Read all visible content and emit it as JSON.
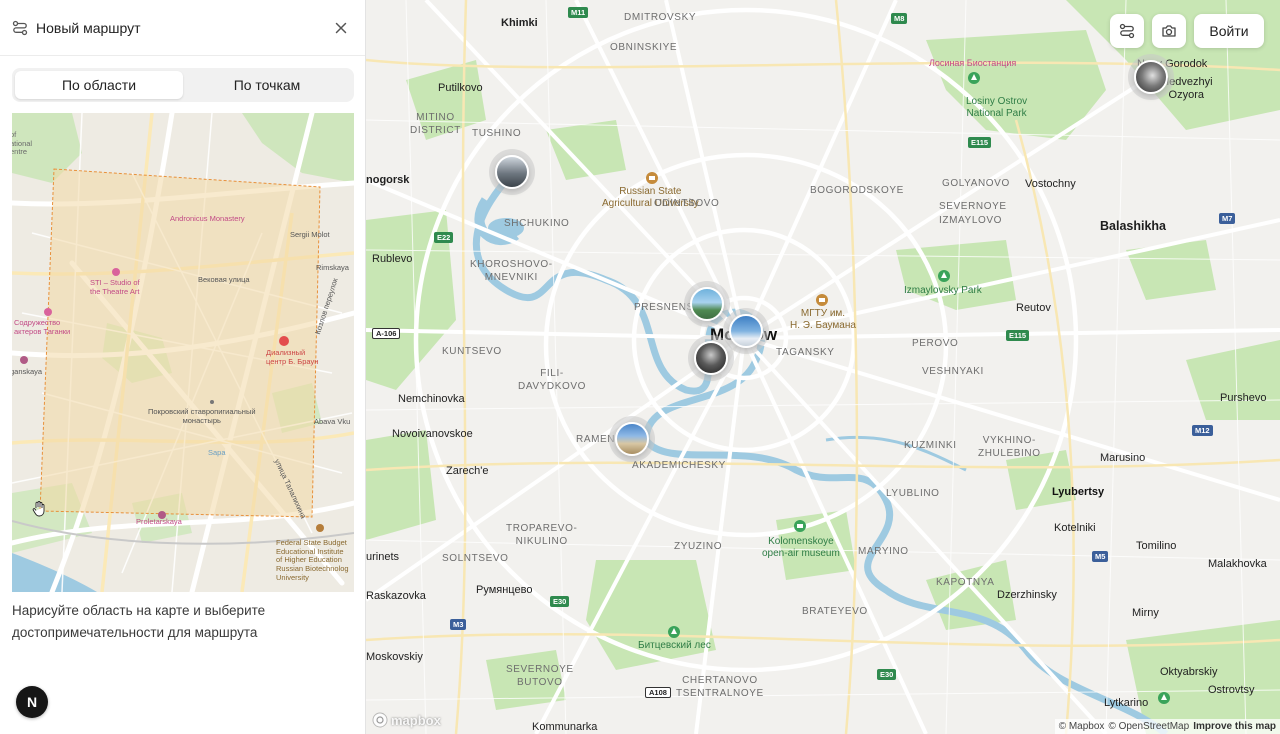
{
  "panel": {
    "title": "Новый маршрут",
    "tabs": [
      {
        "label": "По области",
        "active": true
      },
      {
        "label": "По точкам",
        "active": false
      }
    ],
    "hint": "Нарисуйте область на карте и выберите достопримечательности для маршрута",
    "user_initial": "N"
  },
  "preview_labels": {
    "andronicus": "Andronicus Monastery",
    "sergii": "Sergii Molot",
    "rimskaya": "Rimskaya",
    "sti": "STI – Studio of\nthe Theatre Art",
    "vekovaya": "Вековая улица",
    "sodruzh": "Содружество\nактеров Таганки",
    "taganskaya": "ganskaya",
    "taganskiy": "TAGANSKY",
    "dialysis": "Диализный\nцентр Б. Браун",
    "kozlov": "Козлов переулок",
    "pokrovsky": "Покровский ставропигиальный\nмонастырь",
    "abava": "Abava Vku",
    "sapa": "Sapa",
    "talalikhina": "улица Талалихина",
    "national": "of\national\nentre",
    "proletarskaya": "Proletarskaya",
    "federal": "Federal State Budget\nEducational Institute\nof Higher Education\nRussian Biotechnolog\nUniversity"
  },
  "map": {
    "buttons": {
      "login": "Войти"
    },
    "labels": {
      "khimki": "Khimki",
      "novy_gorodok": "Novy Gorodok",
      "medvezhyi": "Medvezhyi\nOzyora",
      "losiny": "Losiny Ostrov\nNational Park",
      "losinaya": "Лосиная Биостанция",
      "putilkovo": "Putilkovo",
      "krasnogorsk": "nogorsk",
      "rsau": "Russian State\nAgricultural University",
      "balashikha": "Balashikha",
      "golyanovo": "GOLYANOVO",
      "vostochny": "Vostochny",
      "severnoye_izm": "SEVERNOYE\nIZMAYLOVO",
      "bogorodskoye": "BOGORODSKOYE",
      "rublevo": "Rublevo",
      "izmaylovsky_park": "Izmaylovsky Park",
      "reutov": "Reutov",
      "presnensky": "PRESNENSKY",
      "mgtu": "МГТУ им.\nН. Э. Баумана",
      "moscow": "Moscow",
      "taganskiy": "TAGANSKY",
      "perovo": "PEROVO",
      "veshnyaki": "VESHNYAKI",
      "kuntsevo": "KUNTSEVO",
      "fili": "FILI-\nDAVYDKOVO",
      "khoroshovo": "KHOROSHOVO-\nMNEVNIKI",
      "shchukino": "SHCHUKINO",
      "tushino": "TUSHINO",
      "mitino": "MITINO\nDISTRICT",
      "ochakovo": "OBNINSKIYE",
      "nemchinovka": "Nemchinovka",
      "novoivanovskoe": "Novoivanovskoe",
      "ramenki": "RAMENKI",
      "zarechye": "Zarech'e",
      "akademichesky": "AKADEMICHESKY",
      "kuzminki": "KUZMINKI",
      "vykhino": "VYKHINO-\nZHULEBINO",
      "marusino": "Marusino",
      "lyubertsy": "Lyubertsy",
      "purshevo": "Purshevo",
      "lyublino": "LYUBLINO",
      "kolomenskoye": "Kolomenskoye\nopen-air museum",
      "maryino": "MARYINO",
      "kotelniki": "Kotelniki",
      "tomilino": "Tomilino",
      "malakhovka": "Malakhovka",
      "troparevo": "TROPAREVO-\nNIKULINO",
      "solntsevo": "SOLNTSEVO",
      "vnukovo": "urinets",
      "zyuzino": "ZYUZINO",
      "rumyantsevo": "Румянцево",
      "kapotnya": "KAPOTNYA",
      "dzerzhinsky": "Dzerzhinsky",
      "mirny": "Mirny",
      "oktyabrsky": "Oktyabrskiy",
      "bitsevsky": "Битцевский лес",
      "severnoye_butovo": "SEVERNOYE\nBUTOVO",
      "chertanovo": "CHERTANOVO\nTSENTRALNOYE",
      "brateyevo": "BRATEYEVO",
      "moskovskiy": "Moskovskiy",
      "kommunarka": "Kommunarka",
      "lytkarino": "Lytkarino",
      "ostrovtsy": "Ostrovtsy",
      "raskazovka": "Raskazovka",
      "odintsovo_dist": "ODINTSOVO",
      "dmitrovsky": "DMITROVSKY"
    },
    "shields": [
      "M11",
      "M8",
      "E115",
      "E22",
      "A-106",
      "E115",
      "M7",
      "M12",
      "M5",
      "E30",
      "M3",
      "E30",
      "A108",
      "E30"
    ],
    "attribution": {
      "mapbox": "© Mapbox",
      "osm": "© OpenStreetMap",
      "improve": "Improve this map",
      "logo": "mapbox"
    }
  },
  "colors": {
    "park": "#c8e6b4",
    "water": "#9ecae1",
    "road_major": "#ffffff",
    "area_fill": "#f3d9a6",
    "area_border": "#e8903a"
  }
}
